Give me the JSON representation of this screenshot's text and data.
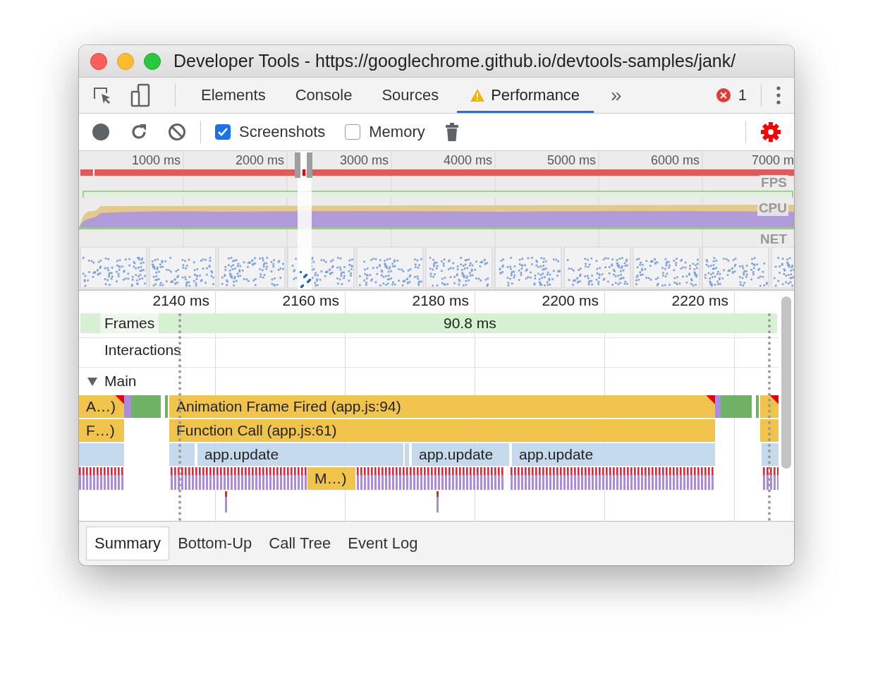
{
  "window": {
    "title": "Developer Tools - https://googlechrome.github.io/devtools-samples/jank/"
  },
  "tabs": [
    {
      "label": "Elements",
      "selected": false,
      "warning": false
    },
    {
      "label": "Console",
      "selected": false,
      "warning": false
    },
    {
      "label": "Sources",
      "selected": false,
      "warning": false
    },
    {
      "label": "Performance",
      "selected": true,
      "warning": true
    }
  ],
  "more_tabs": "»",
  "error_count": "1",
  "toolbar": {
    "options": [
      {
        "label": "Screenshots",
        "checked": true
      },
      {
        "label": "Memory",
        "checked": false
      }
    ]
  },
  "overview": {
    "ruler": [
      "1000 ms",
      "2000 ms",
      "3000 ms",
      "4000 ms",
      "5000 ms",
      "6000 ms",
      "7000 m"
    ],
    "tracks": [
      "FPS",
      "CPU",
      "NET"
    ]
  },
  "timeline": {
    "ruler": [
      "2140 ms",
      "2160 ms",
      "2180 ms",
      "2200 ms",
      "2220 ms"
    ],
    "frames": {
      "label": "Frames",
      "duration": "90.8 ms"
    },
    "interactions": {
      "label": "Interactions"
    },
    "main": {
      "label": "Main",
      "expanded": true,
      "events": [
        {
          "label": "A…)",
          "kind": "event",
          "children": [
            {
              "label": "F…)",
              "kind": "call"
            }
          ]
        },
        {
          "label": "Animation Frame Fired (app.js:94)",
          "kind": "event",
          "children": [
            {
              "label": "Function Call (app.js:61)",
              "kind": "call",
              "children": [
                {
                  "label": "app.update",
                  "kind": "update",
                  "children": [
                    {
                      "label": "M…)",
                      "kind": "call"
                    }
                  ]
                },
                {
                  "label": "app.update",
                  "kind": "update"
                },
                {
                  "label": "app.update",
                  "kind": "update"
                }
              ]
            }
          ]
        }
      ]
    }
  },
  "bottom_tabs": [
    {
      "label": "Summary",
      "selected": true
    },
    {
      "label": "Bottom-Up",
      "selected": false
    },
    {
      "label": "Call Tree",
      "selected": false
    },
    {
      "label": "Event Log",
      "selected": false
    }
  ]
}
